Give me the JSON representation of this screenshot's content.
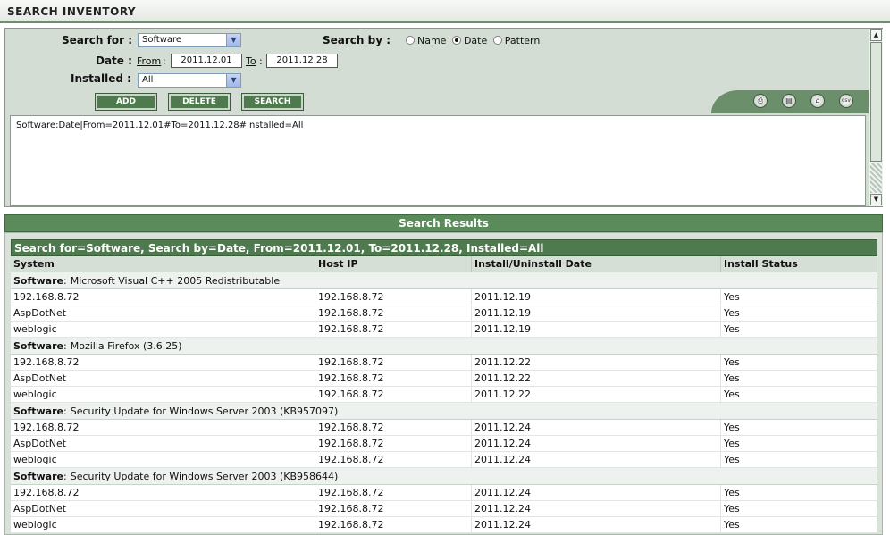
{
  "page": {
    "title": "SEARCH INVENTORY"
  },
  "form": {
    "search_for_label": "Search for :",
    "search_for_value": "Software",
    "search_by_label": "Search by :",
    "search_by_options": [
      {
        "label": "Name",
        "checked": false
      },
      {
        "label": "Date",
        "checked": true
      },
      {
        "label": "Pattern",
        "checked": false
      }
    ],
    "date_label": "Date :",
    "from_label": "From",
    "from_value": "2011.12.01",
    "to_label": "To",
    "to_value": "2011.12.28",
    "installed_label": "Installed :",
    "installed_value": "All",
    "colon": ":"
  },
  "buttons": {
    "add": "ADD",
    "delete": "DELETE",
    "search": "SEARCH"
  },
  "toolbar_icons": [
    "print-icon",
    "document-icon",
    "export-icon",
    "csv-icon"
  ],
  "toolbar_icon_glyphs": [
    "⎙",
    "▤",
    "⌂",
    "csv"
  ],
  "query_text": "Software:Date|From=2011.12.01#To=2011.12.28#Installed=All",
  "results": {
    "title": "Search Results",
    "summary": "Search for=Software, Search by=Date, From=2011.12.01, To=2011.12.28, Installed=All",
    "columns": [
      "System",
      "Host IP",
      "Install/Uninstall Date",
      "Install Status"
    ],
    "group_prefix": "Software",
    "groups": [
      {
        "name": "Microsoft Visual C++ 2005 Redistributable",
        "rows": [
          [
            "192.168.8.72",
            "192.168.8.72",
            "2011.12.19",
            "Yes"
          ],
          [
            "AspDotNet",
            "192.168.8.72",
            "2011.12.19",
            "Yes"
          ],
          [
            "weblogic",
            "192.168.8.72",
            "2011.12.19",
            "Yes"
          ]
        ]
      },
      {
        "name": "Mozilla Firefox (3.6.25)",
        "rows": [
          [
            "192.168.8.72",
            "192.168.8.72",
            "2011.12.22",
            "Yes"
          ],
          [
            "AspDotNet",
            "192.168.8.72",
            "2011.12.22",
            "Yes"
          ],
          [
            "weblogic",
            "192.168.8.72",
            "2011.12.22",
            "Yes"
          ]
        ]
      },
      {
        "name": "Security Update for Windows Server 2003 (KB957097)",
        "rows": [
          [
            "192.168.8.72",
            "192.168.8.72",
            "2011.12.24",
            "Yes"
          ],
          [
            "AspDotNet",
            "192.168.8.72",
            "2011.12.24",
            "Yes"
          ],
          [
            "weblogic",
            "192.168.8.72",
            "2011.12.24",
            "Yes"
          ]
        ]
      },
      {
        "name": "Security Update for Windows Server 2003 (KB958644)",
        "rows": [
          [
            "192.168.8.72",
            "192.168.8.72",
            "2011.12.24",
            "Yes"
          ],
          [
            "AspDotNet",
            "192.168.8.72",
            "2011.12.24",
            "Yes"
          ],
          [
            "weblogic",
            "192.168.8.72",
            "2011.12.24",
            "Yes"
          ]
        ]
      }
    ]
  }
}
